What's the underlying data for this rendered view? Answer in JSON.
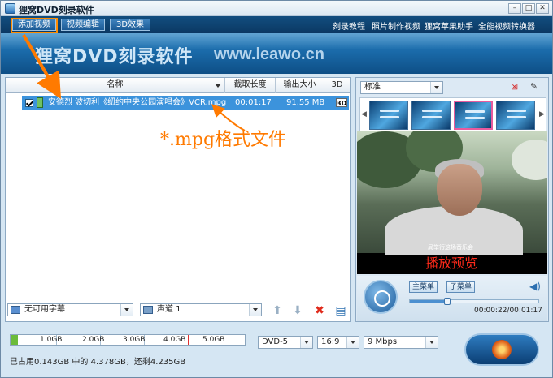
{
  "window": {
    "title": "狸窝DVD刻录软件",
    "min": "–",
    "max": "□",
    "close": "✕"
  },
  "toolbar": {
    "buttons": [
      "添加视频",
      "视频编辑",
      "3D效果"
    ],
    "links": [
      "刻录教程",
      "照片制作视频",
      "狸窝苹果助手",
      "全能视频转换器"
    ]
  },
  "banner": {
    "title": "狸窝DVD刻录软件",
    "url": "www.leawo.cn"
  },
  "filelist": {
    "columns": [
      "名称",
      "截取长度",
      "输出大小",
      "3D"
    ],
    "rows": [
      {
        "name": "安德烈 波切利《纽约中央公园演唱会》VCR.mpg",
        "length": "00:01:17",
        "size": "91.55 MB",
        "badge": "3D"
      }
    ],
    "annotation": "*.mpg格式文件"
  },
  "bottom_controls": {
    "subtitle": "无可用字幕",
    "audio": "声道 1"
  },
  "preview": {
    "style_select": "标准",
    "thumbnail_count": 4,
    "subtitle_text": "一局举行这场音乐会",
    "overlay": "播放预览",
    "main_menu": "主菜单",
    "sub_menu": "子菜单",
    "time": "00:00:22/00:01:17",
    "progress_fraction": 0.29
  },
  "disk": {
    "ticks": [
      "1.0GB",
      "2.0GB",
      "3.0GB",
      "4.0GB",
      "5.0GB"
    ],
    "used_fraction": 0.03,
    "status": "已占用0.143GB 中的 4.378GB，还剩4.235GB",
    "disc_type": "DVD-5",
    "aspect": "16:9",
    "bitrate": "9 Mbps"
  },
  "colors": {
    "accent": "#1a6aa9",
    "selection": "#3c93dc",
    "annotation": "#ff7a00",
    "overlay_text": "#ff2a1a"
  }
}
